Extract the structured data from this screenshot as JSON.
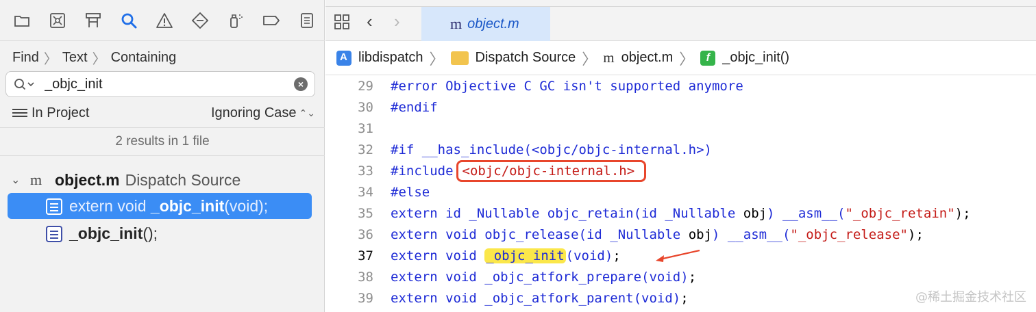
{
  "navigator": {
    "toolbar_icons": [
      "folder-icon",
      "source-control-icon",
      "hierarchy-icon",
      "search-icon",
      "warning-icon",
      "breakpoint-diamond-icon",
      "test-spray-icon",
      "tag-icon",
      "report-icon"
    ],
    "find_path": [
      "Find",
      "Text",
      "Containing"
    ],
    "search": {
      "value": "_objc_init",
      "placeholder": ""
    },
    "scope": "In Project",
    "case_mode": "Ignoring Case",
    "case_chevron": "⌃⌄",
    "results_summary": "2 results in 1 file",
    "file": {
      "name": "object.m",
      "group": "Dispatch Source",
      "icon": "m"
    },
    "results": [
      {
        "pre": "extern void ",
        "match": "_objc_init",
        "post": "(void);",
        "selected": true
      },
      {
        "pre": "",
        "match": "_objc_init",
        "post": "();",
        "selected": false
      }
    ]
  },
  "editor": {
    "tab": {
      "icon": "m",
      "name": "object.m"
    },
    "jumpbar": {
      "project": "libdispatch",
      "group": "Dispatch Source",
      "file_icon": "m",
      "file": "object.m",
      "function_icon": "f",
      "function": "_objc_init()"
    },
    "current_line": 37,
    "lines": [
      {
        "n": "29",
        "text": "#error Objective C GC isn't supported anymore"
      },
      {
        "n": "30",
        "text": "#endif"
      },
      {
        "n": "31",
        "text": ""
      },
      {
        "n": "32",
        "text": "#if __has_include(<objc/objc-internal.h>)"
      },
      {
        "n": "33",
        "a": "#include",
        "b": "<objc/objc-internal.h>"
      },
      {
        "n": "34",
        "text": "#else"
      },
      {
        "n": "35",
        "a": "extern id _Nullable objc_retain(id _Nullable ",
        "b": "obj",
        "c": ") __asm__(",
        "d": "\"_objc_retain\"",
        "e": ");"
      },
      {
        "n": "36",
        "a": "extern void objc_release(id _Nullable ",
        "b": "obj",
        "c": ") __asm__(",
        "d": "\"_objc_release\"",
        "e": ");"
      },
      {
        "n": "37",
        "a": "extern void ",
        "b": "_objc_init",
        "c": "(void)",
        "e": ";"
      },
      {
        "n": "38",
        "a": "extern void _objc_atfork_prepare(void)",
        "e": ";"
      },
      {
        "n": "39",
        "a": "extern void _objc_atfork_parent(void)",
        "e": ";"
      }
    ]
  },
  "watermark": "@稀土掘金技术社区",
  "colors": {
    "selection": "#3b8df5",
    "keyword": "#1e2bd6",
    "string": "#c41a16",
    "highlight_yellow": "#fbe74a",
    "annotation_red": "#e8462c"
  }
}
